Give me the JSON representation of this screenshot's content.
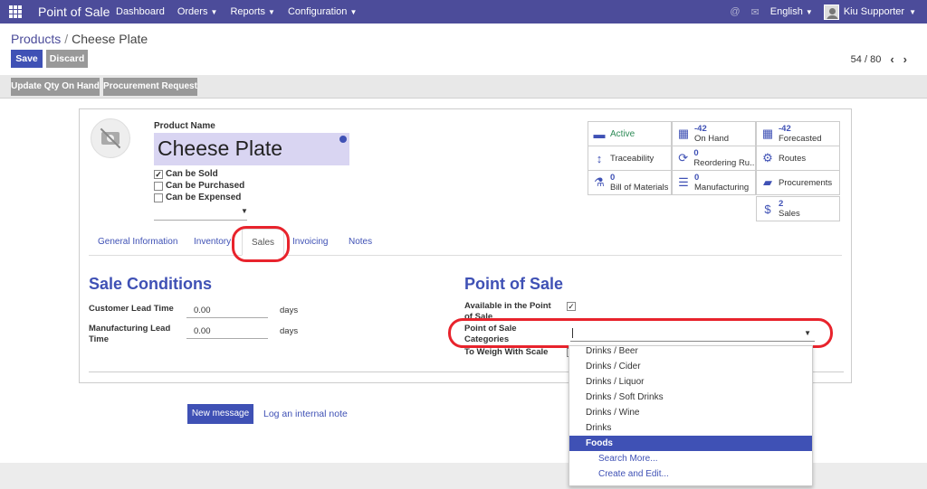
{
  "navbar": {
    "app_name": "Point of Sale",
    "menu": [
      "Dashboard",
      "Orders",
      "Reports",
      "Configuration"
    ],
    "language": "English",
    "user": "Kiu Supporter"
  },
  "breadcrumb": {
    "parent": "Products",
    "separator": "/",
    "current": "Cheese Plate"
  },
  "buttons": {
    "save": "Save",
    "discard": "Discard"
  },
  "pager": {
    "value": "54 / 80"
  },
  "statusbar": {
    "update_qty": "Update Qty On Hand",
    "procurement": "Procurement Request"
  },
  "product": {
    "name_label": "Product Name",
    "name": "Cheese Plate",
    "can_be_sold": "Can be Sold",
    "can_be_purchased": "Can be Purchased",
    "can_be_expensed": "Can be Expensed"
  },
  "smart_buttons": {
    "active": "Active",
    "on_hand_value": "-42",
    "on_hand_label": "On Hand",
    "forecasted_value": "-42",
    "forecasted_label": "Forecasted",
    "traceability": "Traceability",
    "reordering_value": "0",
    "reordering_label": "Reordering Ru...",
    "routes": "Routes",
    "bom_value": "0",
    "bom_label": "Bill of Materials",
    "manufacturing_value": "0",
    "manufacturing_label": "Manufacturing",
    "procurements": "Procurements",
    "sales_value": "2",
    "sales_label": "Sales"
  },
  "tabs": [
    "General Information",
    "Inventory",
    "Sales",
    "Invoicing",
    "Notes"
  ],
  "sale_conditions": {
    "title": "Sale Conditions",
    "customer_lead_label": "Customer Lead Time",
    "customer_lead_value": "0.00",
    "manufacturing_lead_label": "Manufacturing Lead Time",
    "manufacturing_lead_value": "0.00",
    "unit": "days"
  },
  "pos": {
    "title": "Point of Sale",
    "available_label": "Available in the Point of Sale",
    "categories_label": "Point of Sale Categories",
    "weigh_label": "To Weigh With Scale"
  },
  "dropdown": {
    "items": [
      "Drinks / Beer",
      "Drinks / Cider",
      "Drinks / Liquor",
      "Drinks / Soft Drinks",
      "Drinks / Wine",
      "Drinks",
      "Foods"
    ],
    "search_more": "Search More...",
    "create_edit": "Create and Edit..."
  },
  "chatter": {
    "new_message": "New message",
    "log_note": "Log an internal note"
  },
  "colors": {
    "navbar": "#4c4c9a",
    "primary": "#3f51b5",
    "highlight_oval": "#e8232c"
  }
}
